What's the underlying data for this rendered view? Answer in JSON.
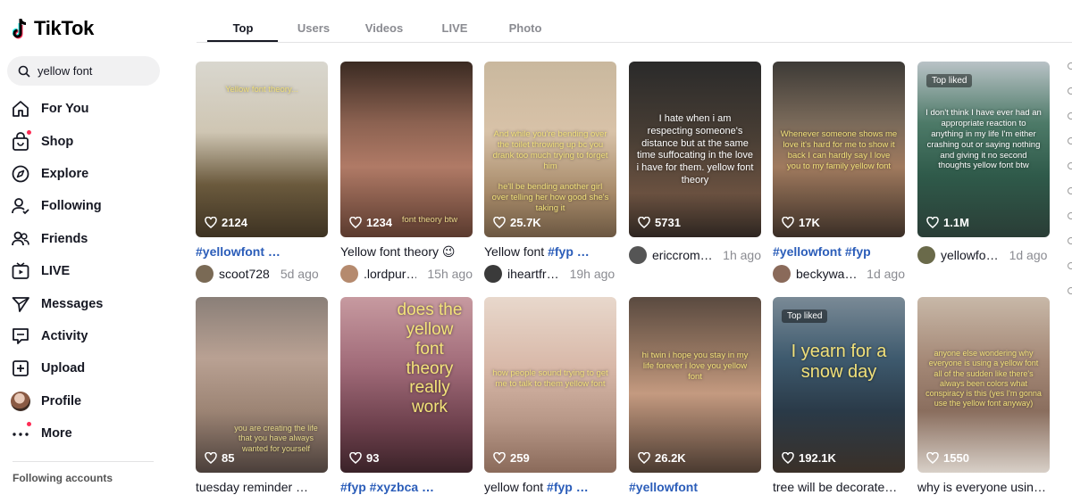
{
  "app": {
    "logo_text": "TikTok"
  },
  "search": {
    "value": "yellow font",
    "icon": "search-icon"
  },
  "sidebar": {
    "items": [
      {
        "label": "For You",
        "icon": "home-icon"
      },
      {
        "label": "Shop",
        "icon": "shopping-bag-icon",
        "badge": true
      },
      {
        "label": "Explore",
        "icon": "compass-icon"
      },
      {
        "label": "Following",
        "icon": "user-follow-icon"
      },
      {
        "label": "Friends",
        "icon": "friends-icon"
      },
      {
        "label": "LIVE",
        "icon": "live-tv-icon"
      },
      {
        "label": "Messages",
        "icon": "send-icon"
      },
      {
        "label": "Activity",
        "icon": "chat-box-icon"
      },
      {
        "label": "Upload",
        "icon": "plus-square-icon"
      },
      {
        "label": "Profile",
        "icon": "avatar"
      },
      {
        "label": "More",
        "icon": "more-dots-icon",
        "badge": true
      }
    ],
    "following_accounts": "Following accounts"
  },
  "tabs": [
    {
      "label": "Top",
      "active": true
    },
    {
      "label": "Users"
    },
    {
      "label": "Videos"
    },
    {
      "label": "LIVE"
    },
    {
      "label": "Photo"
    }
  ],
  "videos": [
    {
      "likes": "2124",
      "overlay": "Yellow font theory...",
      "caption_tag": "#yellowfont …",
      "caption_text": "",
      "user": "scoot728",
      "ago": "5d ago"
    },
    {
      "likes": "1234",
      "overlay": "font theory btw",
      "caption_tag": "",
      "caption_text": "Yellow font theory 😉",
      "user": ".lordpur…",
      "ago": "15h ago"
    },
    {
      "likes": "25.7K",
      "overlay": "And while you're bending over the toilet throwing up bc you drank too much trying to forget him\n\nhe'll be bending another girl over telling her how good she's taking it",
      "caption_text": "Yellow font ",
      "caption_tag": "#fyp …",
      "user": "iheartfr…",
      "ago": "19h ago"
    },
    {
      "likes": "5731",
      "overlay": "I hate when i am respecting someone's distance but at the same time suffocating in the love i have for them. yellow font theory",
      "caption_tag": "",
      "caption_text": "",
      "user": "ericcrom…",
      "ago": "1h ago"
    },
    {
      "likes": "17K",
      "overlay": "Whenever someone shows me love it's hard for me to show it back I can hardly say I love you to my family yellow font",
      "caption_tag": "#yellowfont #fyp",
      "caption_text": "",
      "user": "beckywa…",
      "ago": "1d ago"
    },
    {
      "likes": "1.1M",
      "top_liked": "Top liked",
      "overlay": "I don't think I have ever had an appropriate reaction to anything in my life I'm either crashing out or saying nothing and giving it no second thoughts yellow font btw",
      "caption_tag": "",
      "caption_text": "",
      "user": "yellowfo…",
      "ago": "1d ago"
    },
    {
      "likes": "85",
      "overlay": "you are creating the life that you have always wanted for yourself",
      "caption_text": "tuesday reminder …",
      "caption_tag": ""
    },
    {
      "likes": "93",
      "overlay": "does the yellow font theory really work",
      "caption_tag": "#fyp #xyzbca …",
      "caption_text": ""
    },
    {
      "likes": "259",
      "overlay": "how people sound trying to get me to talk to them yellow font",
      "caption_text": "yellow font ",
      "caption_tag": "#fyp …"
    },
    {
      "likes": "26.2K",
      "overlay": "hi twin i hope you stay in my life forever i love you yellow font",
      "caption_tag": "#yellowfont",
      "caption_text": ""
    },
    {
      "likes": "192.1K",
      "top_liked": "Top liked",
      "overlay": "I yearn for a snow day",
      "caption_text": "tree will be decorate…",
      "caption_tag": ""
    },
    {
      "likes": "1550",
      "overlay": "anyone else wondering why everyone is using a yellow font all of the sudden like there's always been colors what conspiracy is this (yes I'm gonna use the yellow font anyway)",
      "caption_text": "why is everyone usin…",
      "caption_tag": ""
    }
  ],
  "colors": {
    "accent": "#fe2c55",
    "hashtag": "#2b5db9",
    "overlay_text": "#f1e07a"
  }
}
